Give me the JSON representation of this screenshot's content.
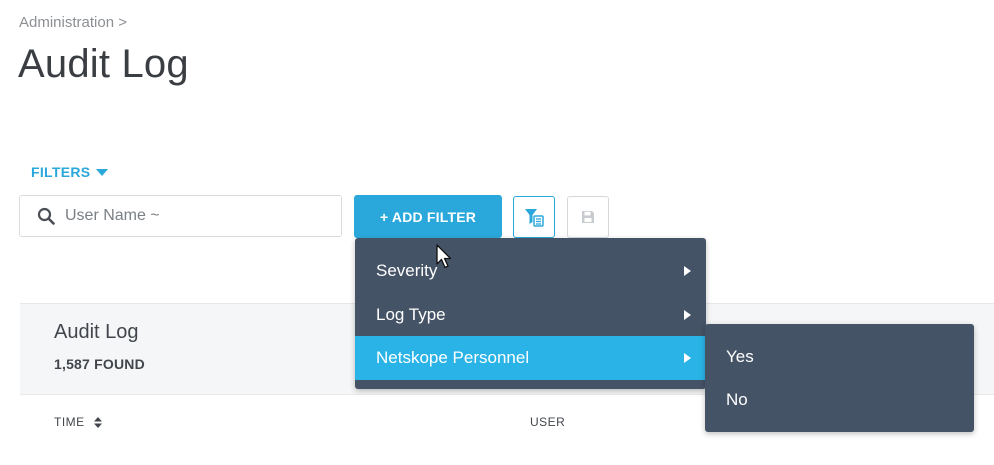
{
  "breadcrumb": {
    "text": "Administration >"
  },
  "page": {
    "title": "Audit Log"
  },
  "filters": {
    "toggle_label": "FILTERS",
    "search_placeholder": "User Name ~",
    "add_filter_label": "+ ADD FILTER"
  },
  "menu": {
    "items": [
      {
        "label": "Severity",
        "has_submenu": true
      },
      {
        "label": "Log Type",
        "has_submenu": true
      },
      {
        "label": "Netskope Personnel",
        "has_submenu": true,
        "active": true
      }
    ],
    "submenu": {
      "parent": "Netskope Personnel",
      "items": [
        {
          "label": "Yes"
        },
        {
          "label": "No"
        }
      ]
    }
  },
  "results": {
    "title": "Audit Log",
    "count": "1,587 FOUND",
    "columns": [
      {
        "label": "TIME",
        "sortable": true
      },
      {
        "label": "USER"
      }
    ]
  },
  "colors": {
    "accent": "#2aa8db",
    "menu_bg": "#455366",
    "menu_active": "#2ab3e6",
    "title": "#3a3d42"
  },
  "icons": {
    "search": "search-icon",
    "filter_list": "filter-list-icon",
    "save": "floppy-disk-icon",
    "sort": "sort-icon",
    "submenu_arrow": "chevron-right-icon",
    "dropdown": "caret-down-icon"
  }
}
